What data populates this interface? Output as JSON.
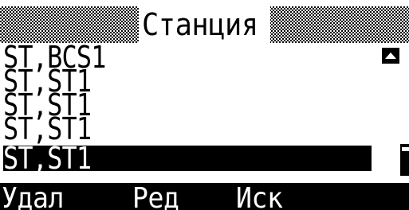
{
  "header": {
    "title": "Станция"
  },
  "list": {
    "items": [
      {
        "label": "ST,BCS1"
      },
      {
        "label": "ST,ST1"
      },
      {
        "label": "ST,ST1"
      },
      {
        "label": "ST,ST1"
      },
      {
        "label": "ST,ST1"
      }
    ],
    "selected_index": 4
  },
  "icons": {
    "scroll_up": "scroll-up-triangle",
    "scroll_thumb": "scrollbar-thumb"
  },
  "softkeys": {
    "delete_label": "Удал",
    "edit_label": "Ред",
    "search_label": "Иск"
  },
  "colors": {
    "foreground": "#000000",
    "background": "#ffffff"
  }
}
